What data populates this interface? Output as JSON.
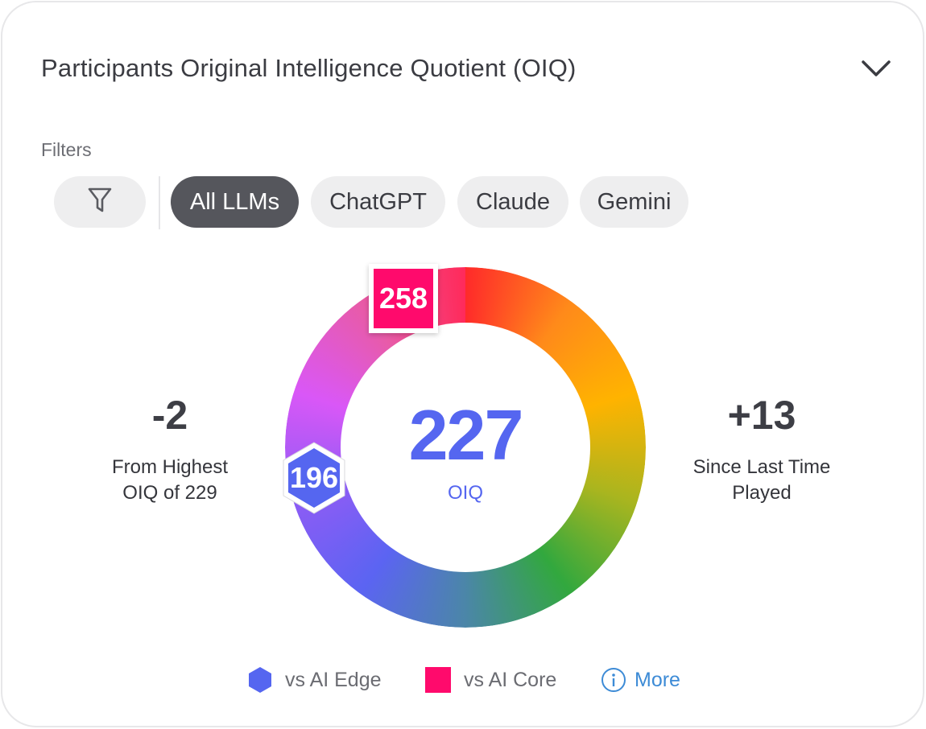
{
  "header": {
    "title": "Participants Original Intelligence Quotient (OIQ)",
    "collapse_icon": "chevron-down-icon"
  },
  "filters": {
    "label": "Filters",
    "filter_icon": "filter-icon",
    "chips": [
      {
        "label": "All LLMs",
        "active": true
      },
      {
        "label": "ChatGPT",
        "active": false
      },
      {
        "label": "Claude",
        "active": false
      },
      {
        "label": "Gemini",
        "active": false
      }
    ]
  },
  "stats": {
    "left": {
      "value": "-2",
      "label_line1": "From Highest",
      "label_line2": "OIQ of 229"
    },
    "right": {
      "value": "+13",
      "label_line1": "Since Last Time",
      "label_line2": "Played"
    }
  },
  "gauge": {
    "value": "227",
    "label": "OIQ",
    "ai_core_badge": "258",
    "ai_edge_badge": "196",
    "gradient_colors": [
      "#ff2a2a",
      "#ff8a1a",
      "#ffb300",
      "#a9b51f",
      "#32a83e",
      "#4b86a8",
      "#5b64f2",
      "#8c5cf5",
      "#d957f7",
      "#e85ba8",
      "#ff2a5a"
    ]
  },
  "legend": {
    "edge_label": "vs AI Edge",
    "core_label": "vs AI Core",
    "more_label": "More",
    "edge_color": "#5566f0",
    "core_color": "#ff0a6c",
    "more_icon": "info-icon"
  }
}
